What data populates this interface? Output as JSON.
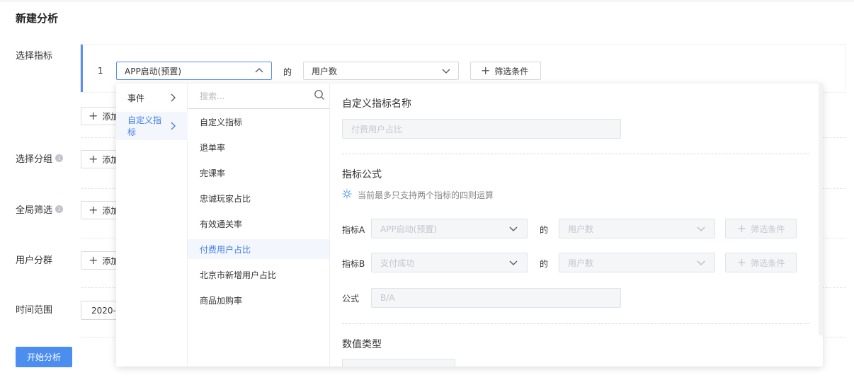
{
  "page": {
    "title": "新建分析"
  },
  "rows": {
    "metric_label": "选择指标",
    "group_label": "选择分组",
    "filter_label": "全局筛选",
    "segment_label": "用户分群",
    "time_label": "时间范围",
    "add_label": "添加",
    "date_value": "2020-0"
  },
  "metric": {
    "index": "1",
    "event_value": "APP启动(预置)",
    "of": "的",
    "measure_value": "用户数",
    "filter_button": "筛选条件"
  },
  "start_button": "开始分析",
  "dropdown": {
    "categories": [
      {
        "label": "事件"
      },
      {
        "label": "自定义指标"
      }
    ],
    "search_placeholder": "搜索...",
    "items": [
      "自定义指标",
      "退单率",
      "完课率",
      "忠诚玩家占比",
      "有效通关率",
      "付费用户占比",
      "北京市新增用户占比",
      "商品加购率"
    ],
    "selected_item": "付费用户占比"
  },
  "detail": {
    "name_title": "自定义指标名称",
    "name_value": "付费用户占比",
    "formula_title": "指标公式",
    "hint": "当前最多只支持两个指标的四则运算",
    "metric_a_label": "指标A",
    "metric_a_event": "APP启动(预置)",
    "metric_a_measure": "用户数",
    "metric_b_label": "指标B",
    "metric_b_event": "支付成功",
    "metric_b_measure": "用户数",
    "of": "的",
    "filter_button": "筛选条件",
    "formula_label": "公式",
    "formula_value": "B/A",
    "value_type_title": "数值类型"
  },
  "colors": {
    "accent": "#4b8ef0",
    "selected_text": "#3f7fe6"
  }
}
